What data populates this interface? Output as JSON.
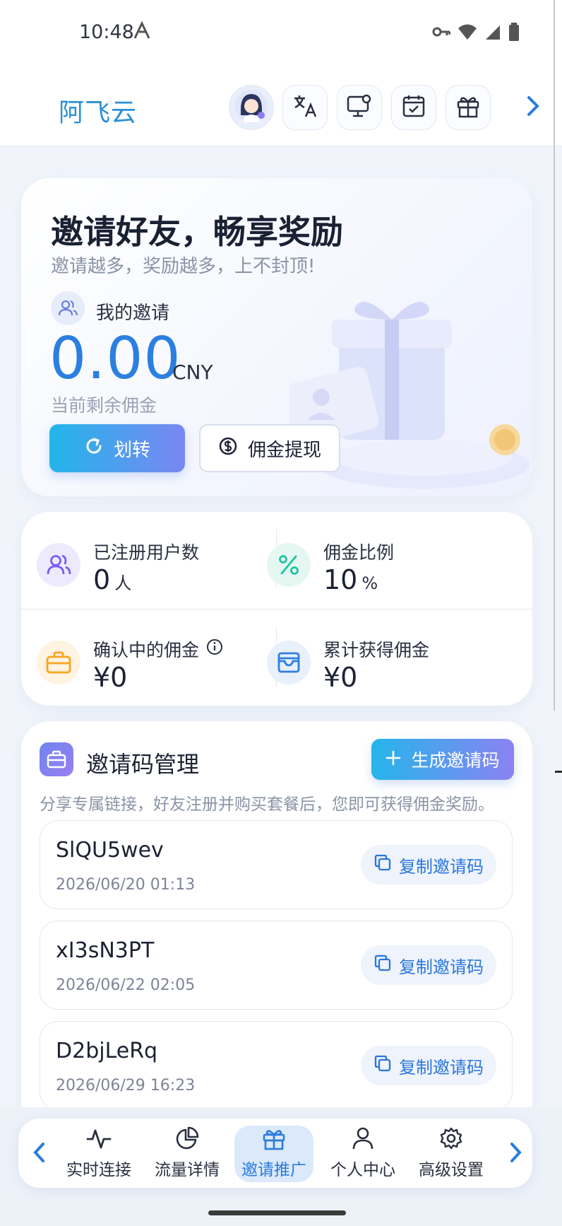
{
  "status_bar": {
    "time": "10:48"
  },
  "app": {
    "title": "阿飞云"
  },
  "top_icons": [
    "avatar-icon",
    "translate-icon",
    "monitor-settings-icon",
    "calendar-check-icon",
    "gift-icon",
    "chevron-right-icon"
  ],
  "hero": {
    "title": "邀请好友，畅享奖励",
    "subtitle": "邀请越多，奖励越多，上不封顶!",
    "my_invite_label": "我的邀请",
    "balance": "0.00",
    "balance_unit": "CNY",
    "balance_note": "当前剩余佣金",
    "transfer_label": "划转",
    "withdraw_label": "佣金提现"
  },
  "stats": {
    "registered": {
      "label": "已注册用户数",
      "value": "0",
      "unit": "人"
    },
    "rate": {
      "label": "佣金比例",
      "value": "10",
      "unit": "%"
    },
    "pending": {
      "label": "确认中的佣金",
      "value": "¥0"
    },
    "total": {
      "label": "累计获得佣金",
      "value": "¥0"
    }
  },
  "invite_codes": {
    "title": "邀请码管理",
    "generate_label": "生成邀请码",
    "description": "分享专属链接，好友注册并购买套餐后，您即可获得佣金奖励。",
    "copy_label": "复制邀请码",
    "items": [
      {
        "code": "SlQU5wev",
        "date": "2026/06/20 01:13"
      },
      {
        "code": "xI3sN3PT",
        "date": "2026/06/22 02:05"
      },
      {
        "code": "D2bjLeRq",
        "date": "2026/06/29 16:23"
      }
    ]
  },
  "bottom_nav": {
    "items": [
      {
        "label": "实时连接",
        "icon": "activity-icon",
        "active": false
      },
      {
        "label": "流量详情",
        "icon": "pie-chart-icon",
        "active": false
      },
      {
        "label": "邀请推广",
        "icon": "gift-icon",
        "active": true
      },
      {
        "label": "个人中心",
        "icon": "user-icon",
        "active": false
      },
      {
        "label": "高级设置",
        "icon": "gear-icon",
        "active": false
      }
    ]
  },
  "colors": {
    "accent": "#2b7fe0",
    "title_blue": "#2b8fd8",
    "gradient_start": "#22b6ea",
    "gradient_end": "#7a86f2"
  }
}
